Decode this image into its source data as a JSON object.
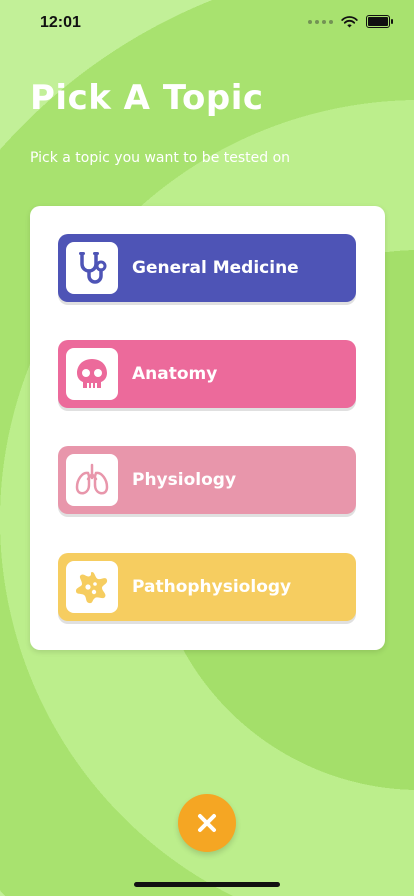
{
  "status_bar": {
    "time": "12:01",
    "icons": [
      "signal-dots-icon",
      "wifi-icon",
      "battery-icon"
    ]
  },
  "header": {
    "title": "Pick A Topic",
    "subtitle": "Pick a topic you want to be tested on"
  },
  "topics": [
    {
      "label": "General Medicine",
      "icon": "stethoscope-icon",
      "color": "#4e54b6"
    },
    {
      "label": "Anatomy",
      "icon": "skull-icon",
      "color": "#ec6a9b"
    },
    {
      "label": "Physiology",
      "icon": "lungs-icon",
      "color": "#e896ab"
    },
    {
      "label": "Pathophysiology",
      "icon": "virus-icon",
      "color": "#f6cd60"
    }
  ],
  "close_button": {
    "icon": "close-icon",
    "color": "#f5a623"
  },
  "colors": {
    "background": "#a9e46f",
    "card": "#ffffff",
    "title_text": "#ffffff"
  }
}
